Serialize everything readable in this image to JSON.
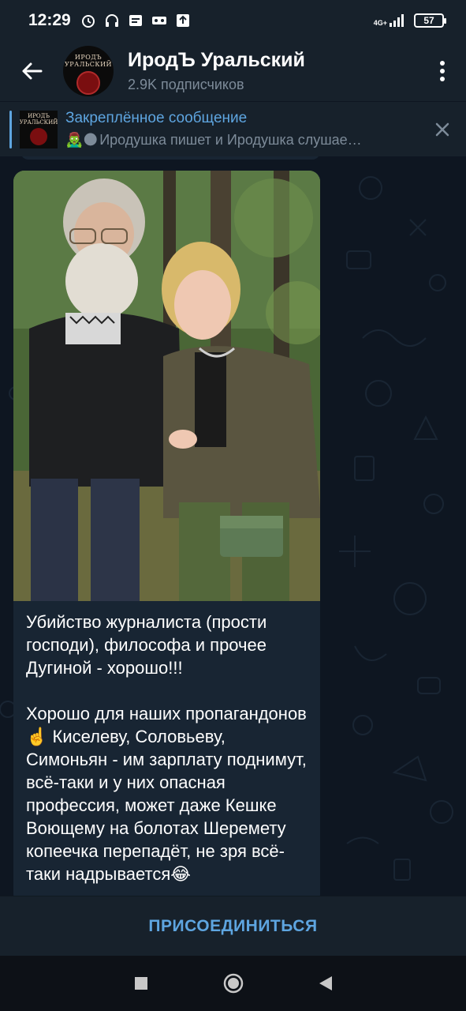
{
  "status_bar": {
    "time": "12:29",
    "network": "4G+",
    "battery": "57"
  },
  "header": {
    "channel_name": "ИродЪ Уральский",
    "subscribers": "2.9K подписчиков",
    "avatar_text": "ИРОДЪ УРАЛЬСКИЙ"
  },
  "pinned": {
    "title": "Закреплённое сообщение",
    "preview_emoji": "🧟‍♂️🌑",
    "preview": "Иродушка пишет и Иродушка слушае…",
    "thumb_text": "ИРОДЪ УРАЛЬСКИЙ"
  },
  "message": {
    "text": "Убийство журналиста (прости господи), философа и прочее Дугиной - хорошо!!!\n\nХорошо для наших пропагандонов☝️ Киселеву, Соловьеву, Симоньян - им зарплату поднимут, всё-таки и у них опасная профессия, может даже Кешке Воющему на болотах Шеремету копеечка перепадёт, не зря всё-таки надрывается😂"
  },
  "join_bar": {
    "label": "ПРИСОЕДИНИТЬСЯ"
  },
  "colors": {
    "background": "#0e1621",
    "header": "#17212b",
    "bubble": "#182533",
    "accent": "#5ea5e0",
    "secondary_text": "#7d8b99"
  },
  "icons": {
    "back": "arrow-left-icon",
    "menu": "more-vertical-icon",
    "close": "close-icon",
    "nav_recent": "square-icon",
    "nav_home": "circle-icon",
    "nav_back": "triangle-back-icon"
  }
}
